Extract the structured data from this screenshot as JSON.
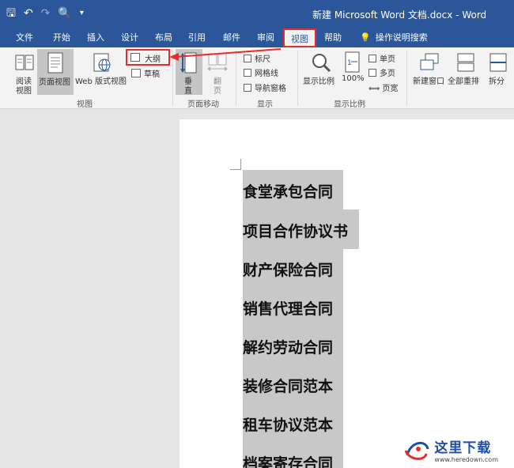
{
  "titlebar": {
    "qat": {
      "save": "🖫",
      "undo": "↶",
      "redo": "↷",
      "preview": "🔍",
      "more": "▾"
    },
    "title": "新建 Microsoft Word 文档.docx  -  Word"
  },
  "tabs": [
    {
      "label": "文件"
    },
    {
      "label": "开始"
    },
    {
      "label": "插入"
    },
    {
      "label": "设计"
    },
    {
      "label": "布局"
    },
    {
      "label": "引用"
    },
    {
      "label": "邮件"
    },
    {
      "label": "审阅"
    },
    {
      "label": "视图",
      "active": true
    },
    {
      "label": "帮助"
    },
    {
      "label": "操作说明搜索"
    }
  ],
  "ribbon": {
    "views": {
      "read_line1": "阅读",
      "read_line2": "视图",
      "page_view": "页面视图",
      "web_view": "Web 版式视图",
      "outline": "大纲",
      "draft": "草稿",
      "group_label": "视图"
    },
    "page_move": {
      "vertical_line1": "垂",
      "vertical_line2": "直",
      "side_line1": "翻",
      "side_line2": "页",
      "group_label": "页面移动"
    },
    "show": {
      "ruler": "标尺",
      "gridlines": "网格线",
      "nav_pane": "导航窗格",
      "group_label": "显示"
    },
    "zoom": {
      "zoom": "显示比例",
      "percent": "100%",
      "one_page": "单页",
      "multi_page": "多页",
      "page_width": "页宽",
      "group_label": "显示比例"
    },
    "window": {
      "new_window": "新建窗口",
      "arrange_all": "全部重排",
      "split": "拆分"
    }
  },
  "document": {
    "lines": [
      "食堂承包合同",
      "项目合作协议书",
      "财产保险合同",
      "销售代理合同",
      "解约劳动合同",
      "装修合同范本",
      "租车协议范本",
      "档案寄存合同"
    ]
  },
  "watermark": {
    "name": "这里下载",
    "url": "www.heredown.com"
  },
  "colors": {
    "title_bar": "#2b579a",
    "highlight": "#e82c2c",
    "selection": "#c8c8c8"
  }
}
